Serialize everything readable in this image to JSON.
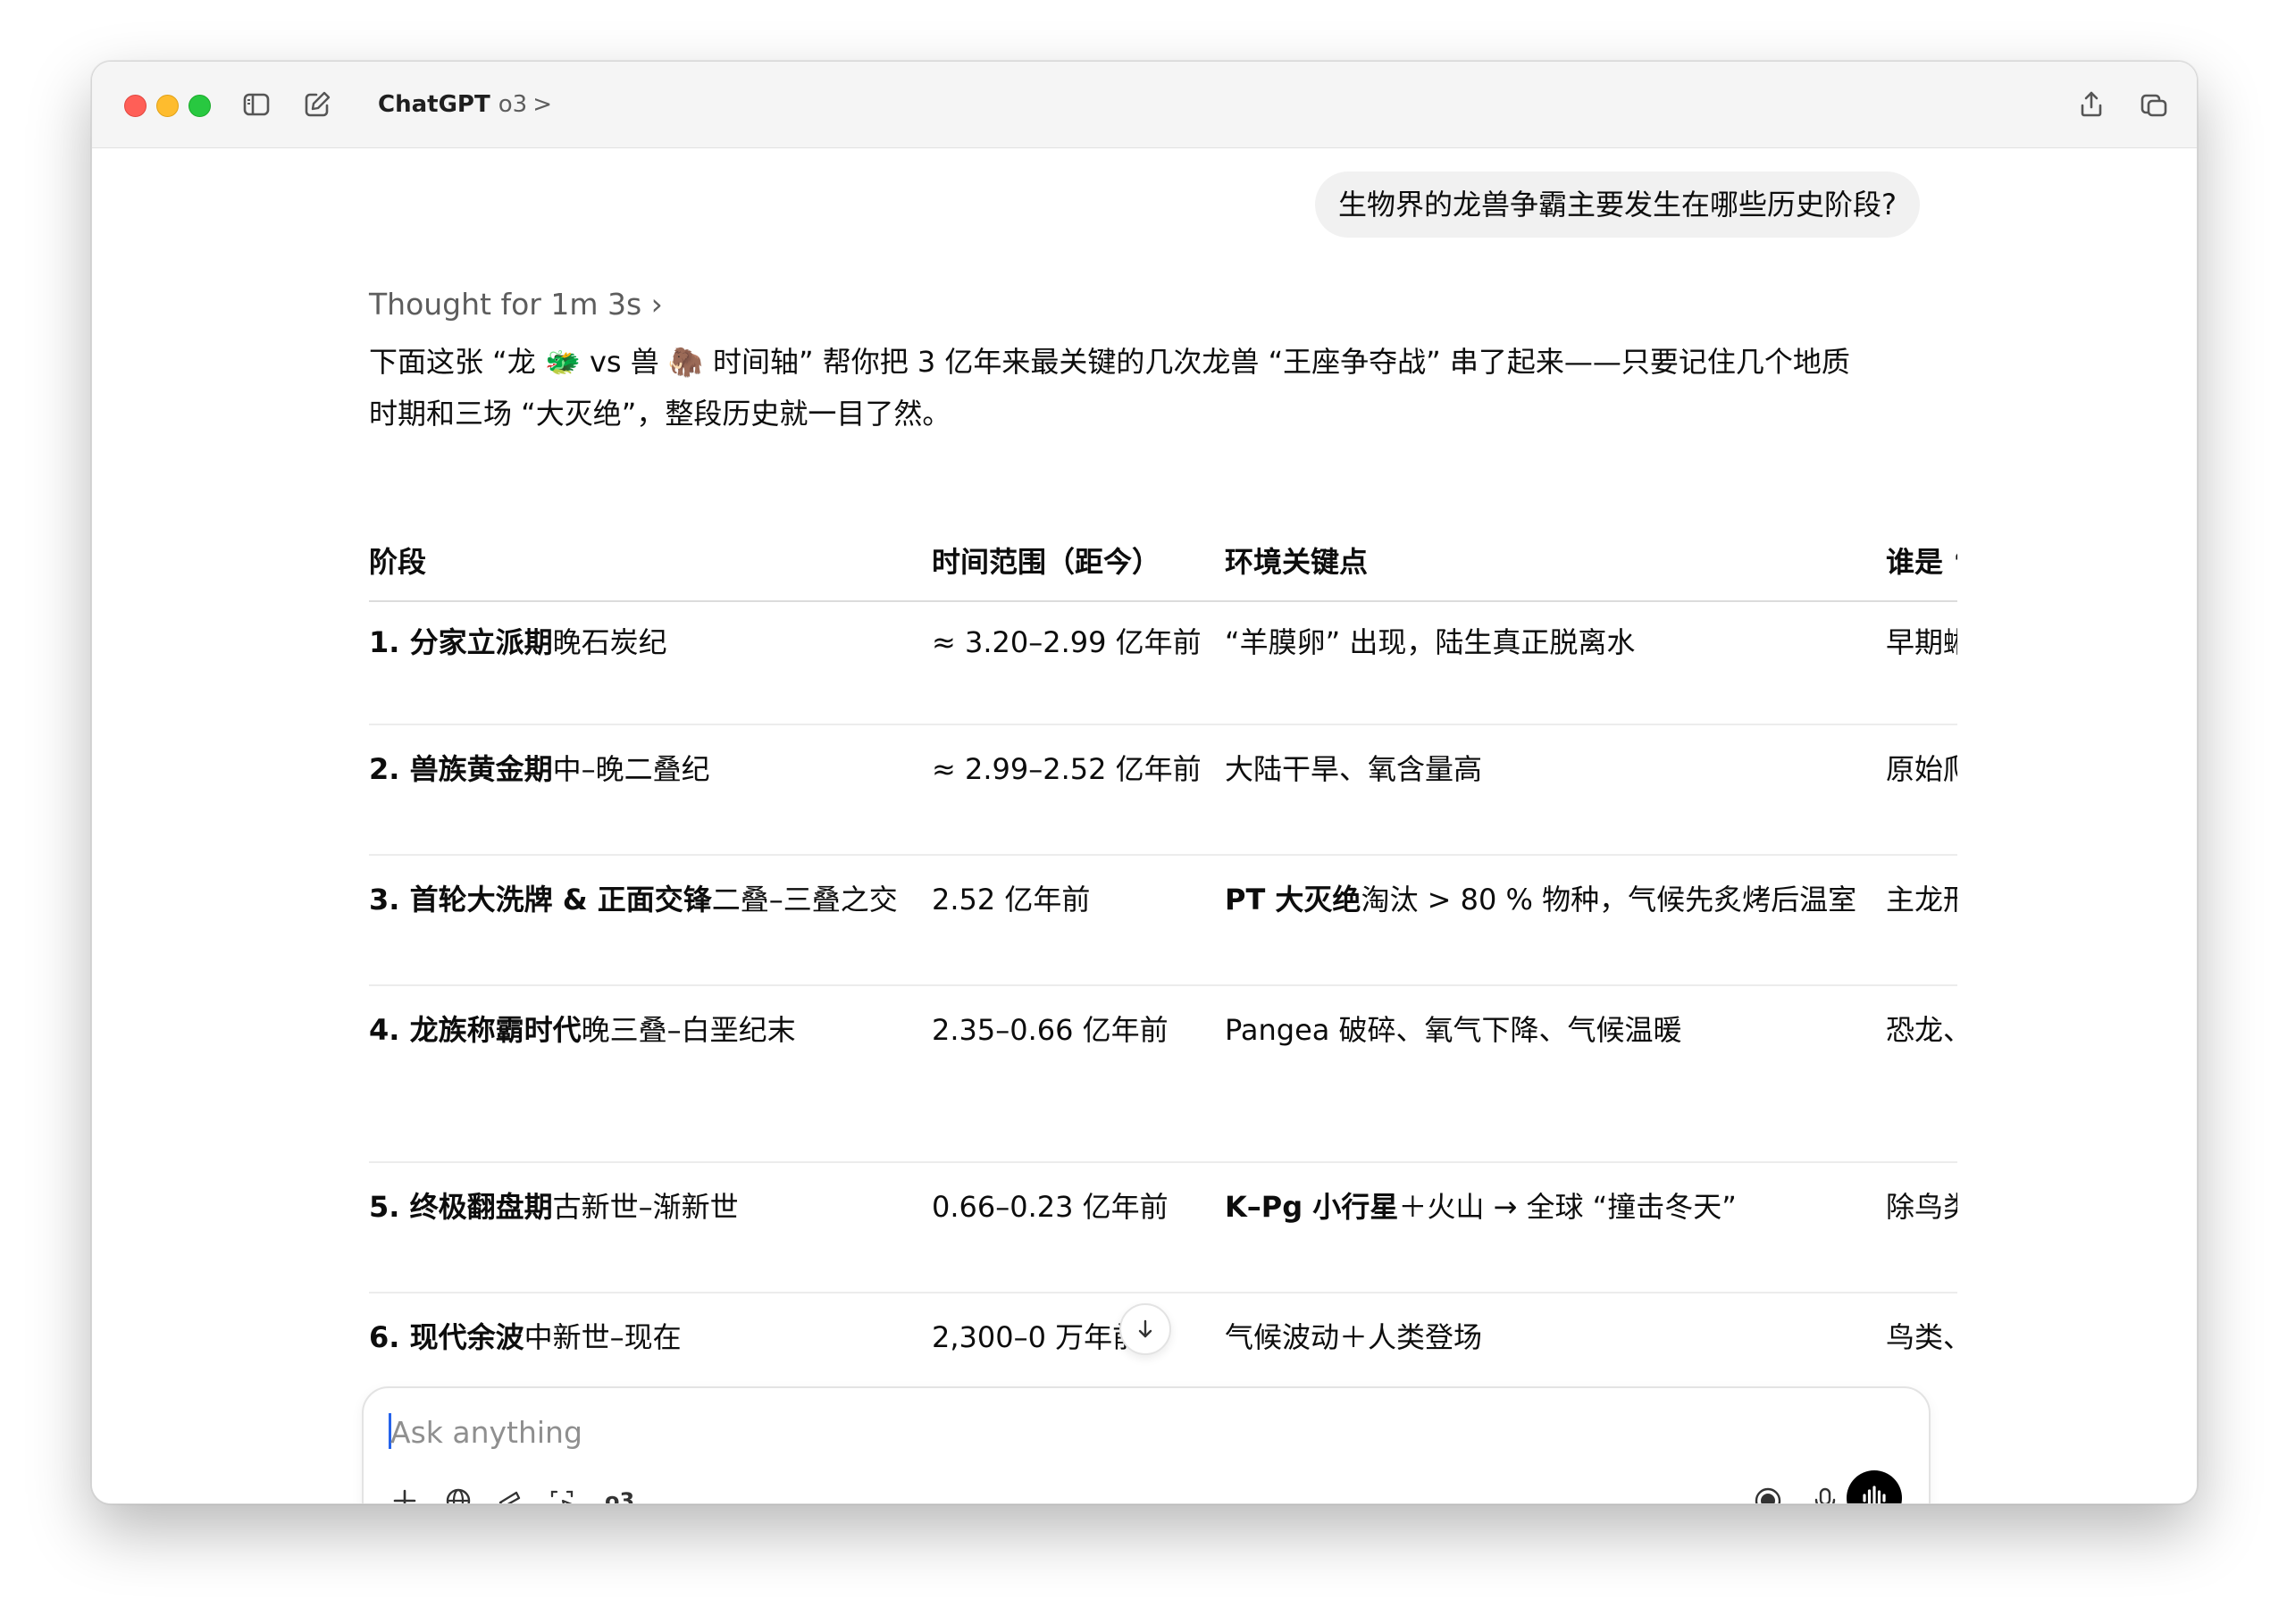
{
  "window": {
    "app_title": "ChatGPT",
    "model": "o3",
    "model_chevron": ">"
  },
  "chat": {
    "user_message": "生物界的龙兽争霸主要发生在哪些历史阶段?",
    "thought_label": "Thought for 1m 3s ›",
    "intro": {
      "line1_a": "下面这张 “龙 ",
      "emoji_dragon": "🐲",
      "line1_b": " vs 兽 ",
      "emoji_mammoth": "🦣",
      "line1_c": " 时间轴” 帮你把 3 亿年来最关键的几次龙兽 “王座争夺战” 串了起来——只要记住几个地质",
      "line2": "时期和三场 “大灭绝”，整段历史就一目了然。"
    },
    "table": {
      "headers": [
        "阶段",
        "时间范围（距今）",
        "环境关键点",
        "谁是 ‘"
      ],
      "rows": [
        {
          "stage_bold": "1. 分家立派期",
          "stage_rest": "晚石炭纪",
          "time": "≈ 3.20–2.99 亿年前",
          "env_bold": "",
          "env_rest": "“羊膜卵” 出现，陆生真正脱离水",
          "who": "早期蜥"
        },
        {
          "stage_bold": "2. 兽族黄金期",
          "stage_rest": "中–晚二叠纪",
          "time": "≈ 2.99–2.52 亿年前",
          "env_bold": "",
          "env_rest": "大陆干旱、氧含量高",
          "who": "原始爬"
        },
        {
          "stage_bold": "3. 首轮大洗牌 & 正面交锋",
          "stage_rest": "二叠–三叠之交",
          "time": "2.52 亿年前",
          "env_bold": "PT 大灭绝",
          "env_rest": "淘汰 > 80 % 物种，气候先炙烤后温室",
          "who": "主龙形"
        },
        {
          "stage_bold": "4. 龙族称霸时代",
          "stage_rest": "晚三叠–白垩纪末",
          "time": "2.35–0.66 亿年前",
          "env_bold": "",
          "env_rest": "Pangea 破碎、氧气下降、气候温暖",
          "who": "恐龙、"
        },
        {
          "stage_bold": "5. 终极翻盘期",
          "stage_rest": "古新世–渐新世",
          "time": "0.66–0.23 亿年前",
          "env_bold": "K–Pg 小行星",
          "env_rest": "＋火山 → 全球 “撞击冬天”",
          "who": "除鸟类"
        },
        {
          "stage_bold": "6. 现代余波",
          "stage_rest": "中新世–现在",
          "time": "2,300–0 万年前",
          "env_bold": "",
          "env_rest": "气候波动＋人类登场",
          "who": "鸟类、"
        }
      ]
    }
  },
  "composer": {
    "placeholder": "Ask anything",
    "model_tag": "o3"
  }
}
